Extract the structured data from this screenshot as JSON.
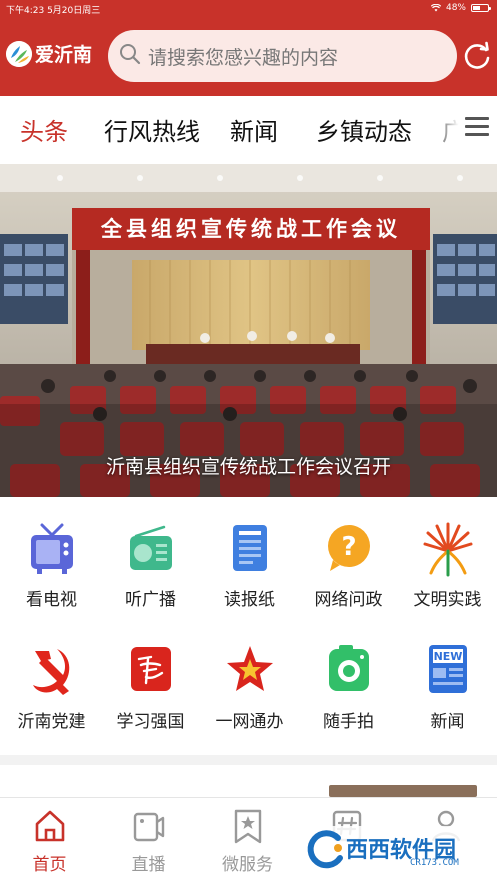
{
  "status_bar": {
    "time_date": "下午4:23  5月20日周三",
    "battery": "48%",
    "battery_level": 0.48
  },
  "header": {
    "app_name": "爱沂南",
    "search_placeholder": "请搜索您感兴趣的内容",
    "logo_icon": "aiyinan-logo",
    "search_icon": "search-icon",
    "refresh_icon": "refresh-icon"
  },
  "tabs": [
    {
      "label": "头条",
      "active": true
    },
    {
      "label": "行风热线",
      "active": false
    },
    {
      "label": "新闻",
      "active": false
    },
    {
      "label": "乡镇动态",
      "active": false
    },
    {
      "label": "广",
      "active": false
    }
  ],
  "banner": {
    "caption": "沂南县组织宣传统战工作会议召开",
    "slogan": "全县组织宣传统战工作会议"
  },
  "grid": [
    {
      "label": "看电视",
      "icon": "tv-icon"
    },
    {
      "label": "听广播",
      "icon": "radio-icon"
    },
    {
      "label": "读报纸",
      "icon": "newspaper-icon"
    },
    {
      "label": "网络问政",
      "icon": "question-icon"
    },
    {
      "label": "文明实践",
      "icon": "civilization-icon"
    },
    {
      "label": "沂南党建",
      "icon": "party-emblem-icon"
    },
    {
      "label": "学习强国",
      "icon": "xuexi-icon"
    },
    {
      "label": "一网通办",
      "icon": "star-icon"
    },
    {
      "label": "随手拍",
      "icon": "camera-icon"
    },
    {
      "label": "新闻",
      "icon": "news-icon",
      "badge": "NEW"
    }
  ],
  "bottom_nav": [
    {
      "label": "首页",
      "icon": "home-icon",
      "active": true
    },
    {
      "label": "直播",
      "icon": "video-icon",
      "active": false
    },
    {
      "label": "微服务",
      "icon": "bookmark-star-icon",
      "active": false
    },
    {
      "label": "",
      "icon": "hashtag-icon",
      "active": false
    },
    {
      "label": "",
      "icon": "user-icon",
      "active": false
    }
  ],
  "watermark": {
    "text": "西西软件园",
    "url": "CR173.COM"
  },
  "colors": {
    "brand_red": "#c8322a",
    "search_bg": "#fbe9e6",
    "inactive_gray": "#999999"
  }
}
